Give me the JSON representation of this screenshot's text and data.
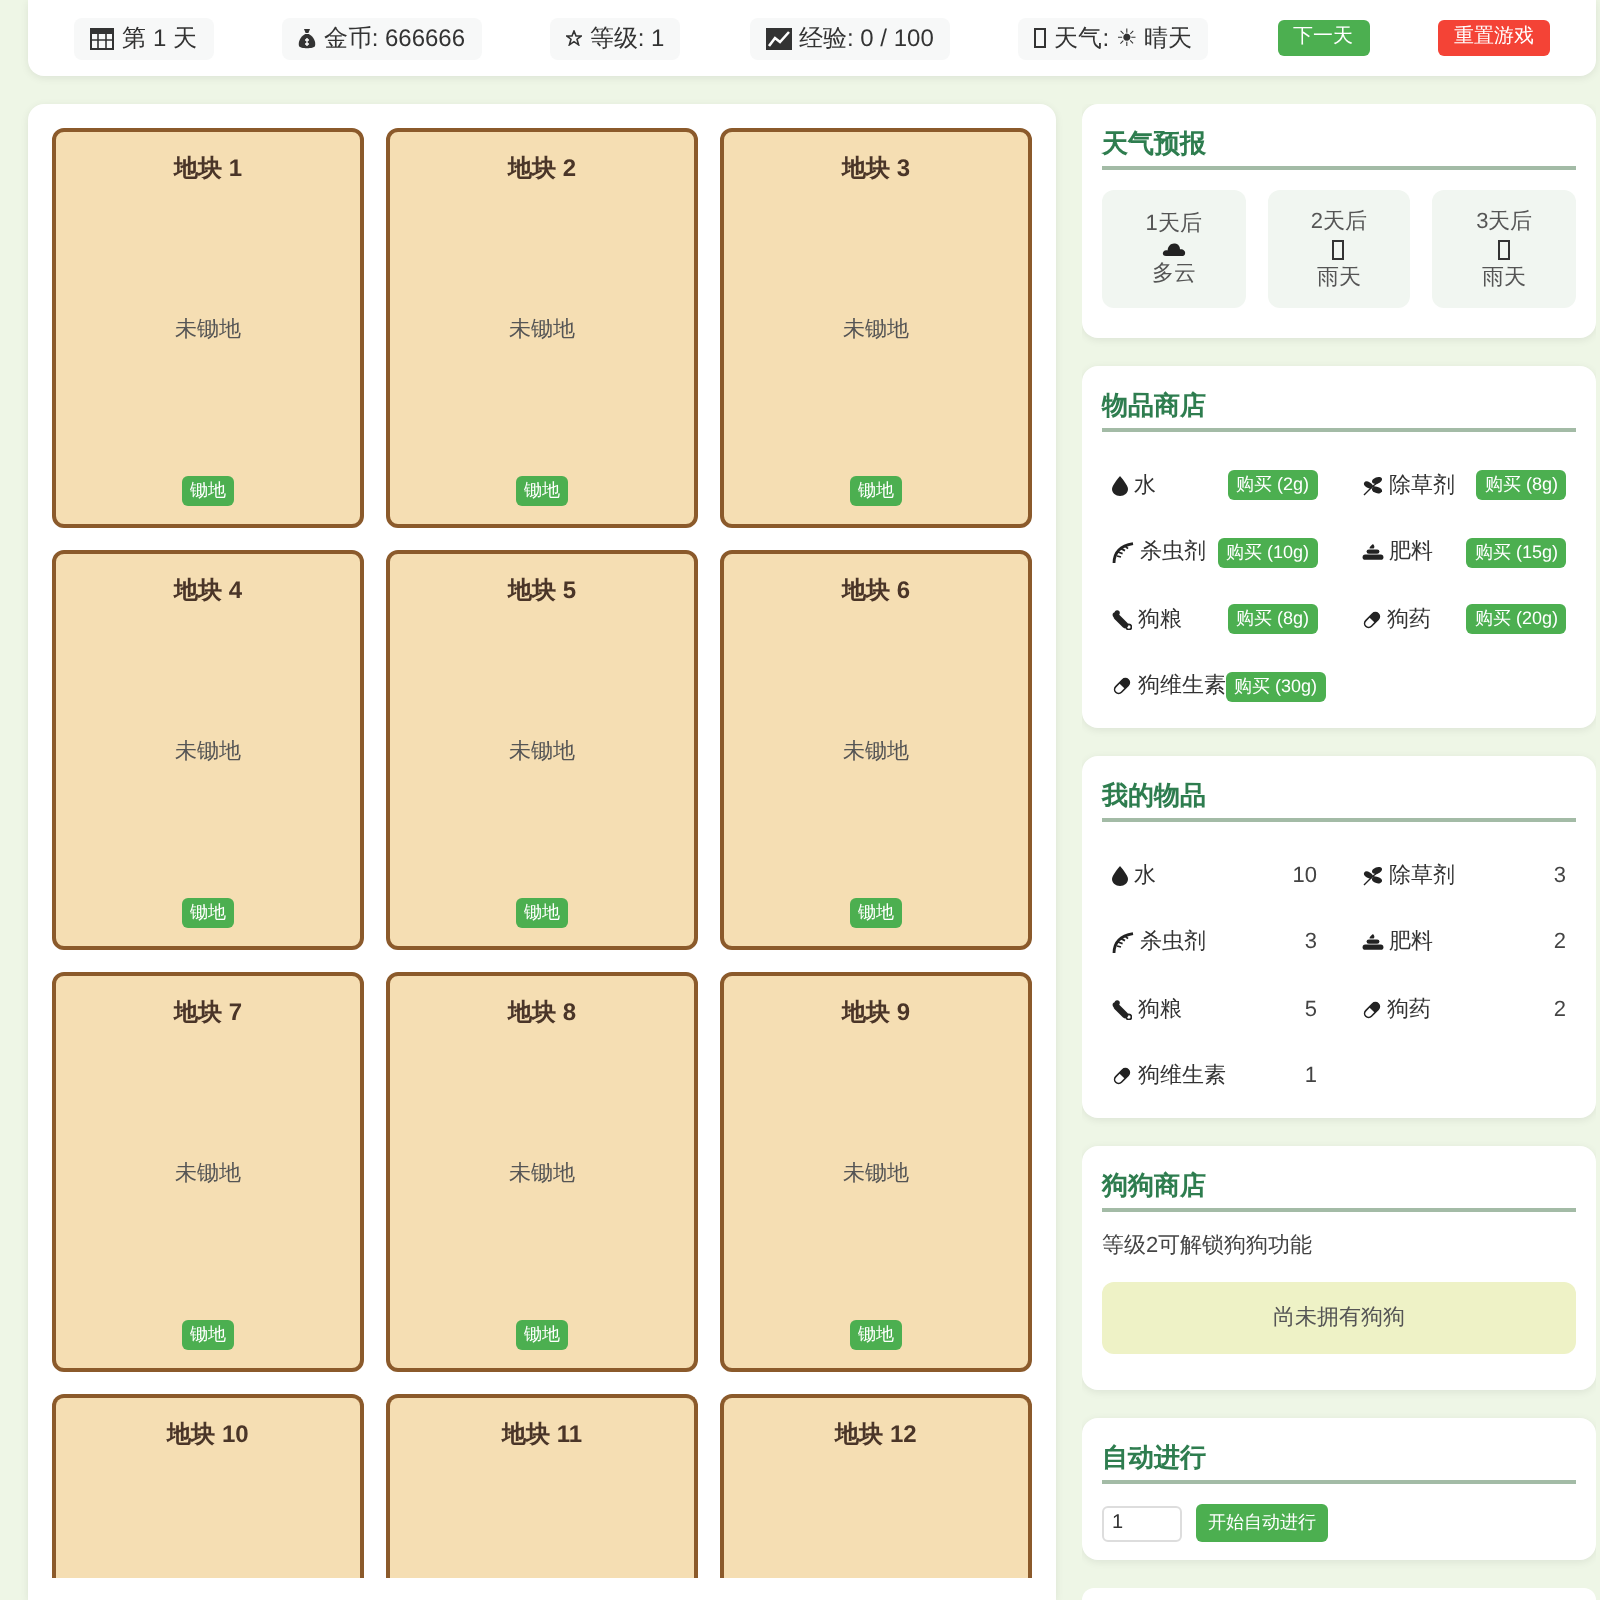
{
  "top_bar": {
    "stats": [
      {
        "kind": "day",
        "text": "第 1 天"
      },
      {
        "kind": "coins",
        "text": "金币: 666666"
      },
      {
        "kind": "level",
        "text": "等级: 1"
      },
      {
        "kind": "exp",
        "text": "经验: 0 / 100"
      },
      {
        "kind": "weather",
        "text": "天气: ☀ 晴天"
      }
    ],
    "buttons": [
      {
        "kind": "primary",
        "label": "下一天"
      },
      {
        "kind": "danger",
        "label": "重置游戏"
      }
    ]
  },
  "plots": [
    {
      "title": "地块 1",
      "status": "未锄地",
      "action": "锄地"
    },
    {
      "title": "地块 2",
      "status": "未锄地",
      "action": "锄地"
    },
    {
      "title": "地块 3",
      "status": "未锄地",
      "action": "锄地"
    },
    {
      "title": "地块 4",
      "status": "未锄地",
      "action": "锄地"
    },
    {
      "title": "地块 5",
      "status": "未锄地",
      "action": "锄地"
    },
    {
      "title": "地块 6",
      "status": "未锄地",
      "action": "锄地"
    },
    {
      "title": "地块 7",
      "status": "未锄地",
      "action": "锄地"
    },
    {
      "title": "地块 8",
      "status": "未锄地",
      "action": "锄地"
    },
    {
      "title": "地块 9",
      "status": "未锄地",
      "action": "锄地"
    },
    {
      "title": "地块 10"
    },
    {
      "title": "地块 11"
    },
    {
      "title": "地块 12"
    }
  ],
  "weather_forecast": {
    "title": "天气预报",
    "days": [
      {
        "label": "1天后",
        "kind": "cloudy",
        "weather": "多云"
      },
      {
        "label": "2天后",
        "kind": "rainy",
        "weather": "雨天"
      },
      {
        "label": "3天后",
        "kind": "rainy",
        "weather": "雨天"
      }
    ]
  },
  "item_shop": {
    "title": "物品商店",
    "items": [
      {
        "kind": "water",
        "name": "水",
        "button": "购买 (2g)"
      },
      {
        "kind": "herbicide",
        "name": "除草剂",
        "button": "购买 (8g)"
      },
      {
        "kind": "pesticide",
        "name": "杀虫剂",
        "button": "购买 (10g)"
      },
      {
        "kind": "fertilizer",
        "name": "肥料",
        "button": "购买 (15g)"
      },
      {
        "kind": "dog_food",
        "name": "狗粮",
        "button": "购买 (8g)"
      },
      {
        "kind": "dog_medicine",
        "name": "狗药",
        "button": "购买 (20g)"
      },
      {
        "kind": "dog_vitamin",
        "name": "狗维生素",
        "button": "购买 (30g)"
      }
    ]
  },
  "inventory": {
    "title": "我的物品",
    "items": [
      {
        "kind": "water",
        "name": "水",
        "count": "10"
      },
      {
        "kind": "herbicide",
        "name": "除草剂",
        "count": "3"
      },
      {
        "kind": "pesticide",
        "name": "杀虫剂",
        "count": "3"
      },
      {
        "kind": "fertilizer",
        "name": "肥料",
        "count": "2"
      },
      {
        "kind": "dog_food",
        "name": "狗粮",
        "count": "5"
      },
      {
        "kind": "dog_medicine",
        "name": "狗药",
        "count": "2"
      },
      {
        "kind": "dog_vitamin",
        "name": "狗维生素",
        "count": "1"
      }
    ]
  },
  "dog_shop": {
    "title": "狗狗商店",
    "note": "等级2可解锁狗狗功能",
    "empty_message": "尚未拥有狗狗"
  },
  "auto_run": {
    "title": "自动进行",
    "input_value": "1",
    "button": "开始自动进行"
  }
}
